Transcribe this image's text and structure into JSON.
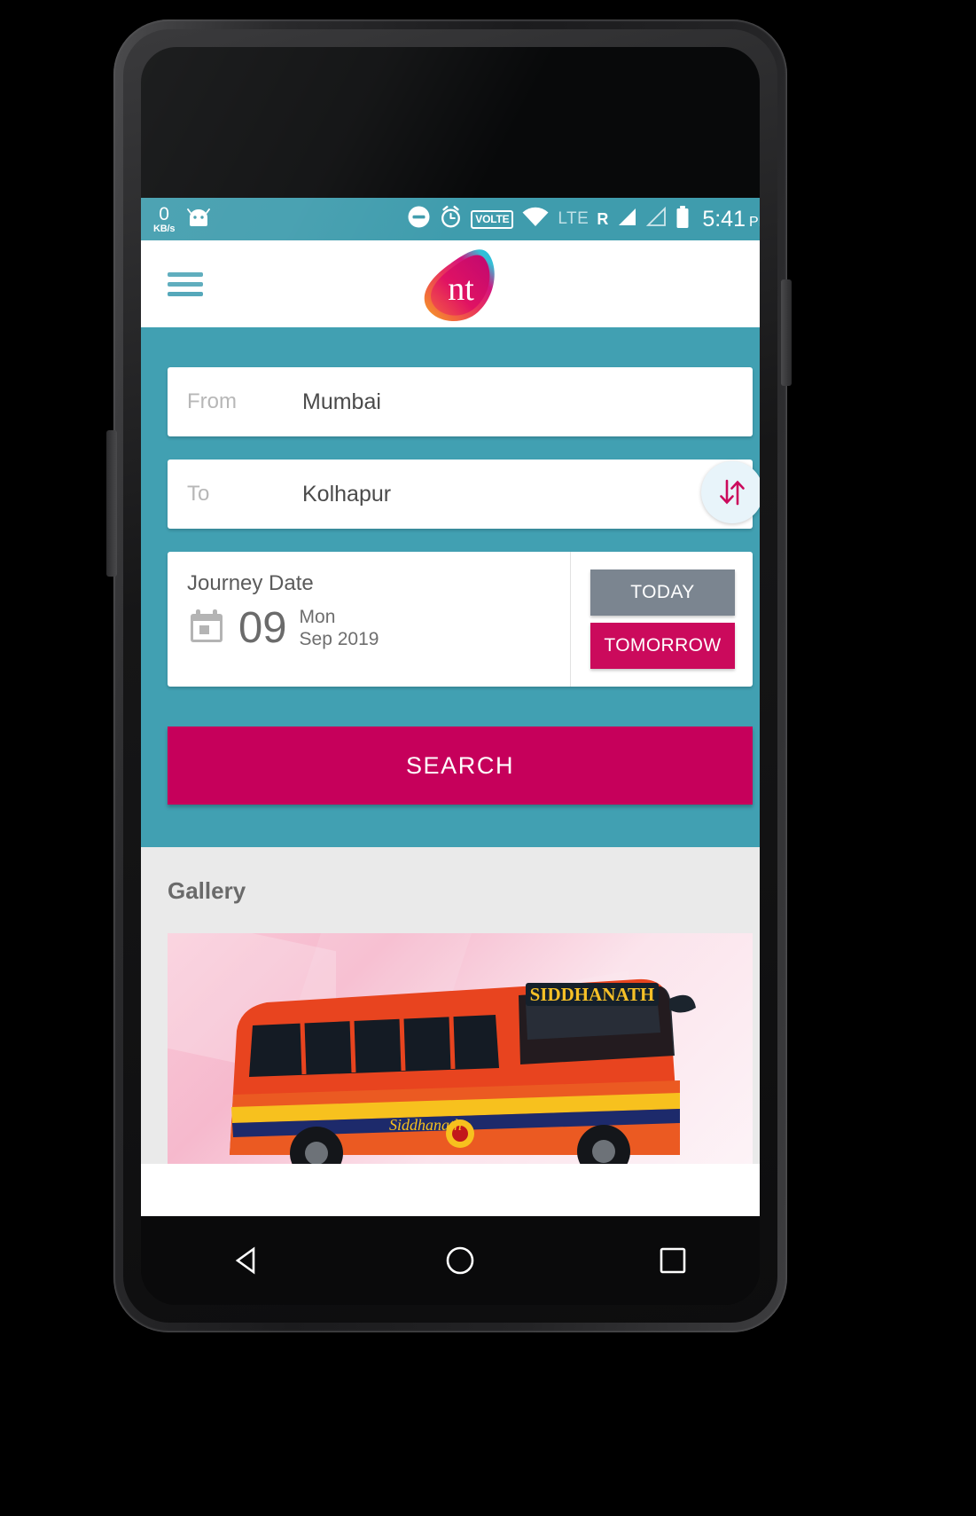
{
  "status_bar": {
    "net_speed_value": "0",
    "net_speed_unit": "KB/s",
    "android_icon": "android-robot-icon",
    "dnd_icon": "do-not-disturb-icon",
    "alarm_icon": "alarm-clock-icon",
    "volte_label": "VOLTE",
    "wifi_icon": "wifi-icon",
    "network_type": "LTE",
    "roaming": "R",
    "signal_icon_1": "signal-bars-full-icon",
    "signal_icon_2": "signal-bars-empty-icon",
    "battery_icon": "battery-full-icon",
    "time": "5:41",
    "meridiem": "PM",
    "bg_color": "#3f9cad"
  },
  "app_bar": {
    "menu_icon": "hamburger-menu-icon",
    "logo_text": "nt",
    "logo_name": "nt-brand-logo"
  },
  "search_panel": {
    "bg_color": "#41a0b2",
    "from": {
      "label": "From",
      "value": "Mumbai"
    },
    "to": {
      "label": "To",
      "value": "Kolhapur"
    },
    "swap_icon": "swap-vertical-arrows-icon",
    "journey": {
      "title": "Journey Date",
      "calendar_icon": "calendar-icon",
      "day": "09",
      "weekday": "Mon",
      "month_year": "Sep 2019",
      "today_label": "TODAY",
      "tomorrow_label": "TOMORROW",
      "today_color": "#7b8590",
      "tomorrow_color": "#cb0a5c"
    },
    "search_label": "SEARCH",
    "search_color": "#c6005b"
  },
  "gallery": {
    "title": "Gallery",
    "image_name": "siddhanath-bus-photo",
    "image_caption": "SIDDHANATH"
  },
  "nav_bar": {
    "back_icon": "back-triangle-icon",
    "home_icon": "home-circle-icon",
    "recents_icon": "recents-square-icon"
  }
}
